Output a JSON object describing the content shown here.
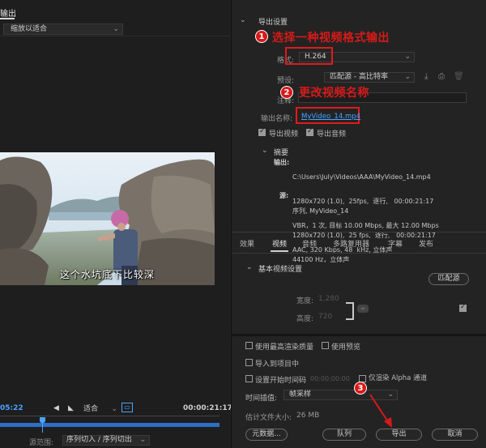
{
  "left": {
    "tab_label": "输出",
    "fit_dropdown": "缩放以适合",
    "subtitle": "这个水坑底下比较深",
    "timecode_current": "05:22",
    "timecode_total": "00:00:21:17",
    "fit_small": "适合",
    "range_label": "源范围:",
    "range_value": "序列切入 / 序列切出"
  },
  "export_settings": {
    "title": "导出设置",
    "format_label": "格式:",
    "format_value": "H.264",
    "preset_label": "预设:",
    "preset_value": "匹配源 - 高比特率",
    "comments_label": "注释:",
    "output_name_label": "输出名称:",
    "output_name_value": "MyVideo_14.mp4",
    "export_video_label": "导出视频",
    "export_audio_label": "导出音频"
  },
  "summary": {
    "title": "摘要",
    "output_label": "输出:",
    "output_lines": [
      "C:\\Users\\July\\Videos\\AAA\\MyVideo_14.mp4",
      "1280x720 (1.0),  25fps,  逐行,   00:00:21:17",
      "VBR，1 次, 目标 10.00 Mbps, 最大 12.00 Mbps",
      "AAC, 320 Kbps, 48  kHz, 立体声"
    ],
    "source_label": "源:",
    "source_lines": [
      "序列, MyVideo_14",
      "1280x720 (1.0),  25 fps,  逐行,   00:00:21:17",
      "44100 Hz，立体声"
    ]
  },
  "tabs": [
    "效果",
    "视频",
    "音频",
    "多路复用器",
    "字幕",
    "发布"
  ],
  "basic_video": {
    "title": "基本视频设置",
    "match_source_btn": "匹配源",
    "width_label": "宽度:",
    "width_value": "1,280",
    "height_label": "高度:",
    "height_value": "720"
  },
  "options": {
    "max_render_quality": "使用最高渲染质量",
    "use_previews": "使用预览",
    "import_into_project": "导入到项目中",
    "set_start_timecode": "设置开始时间码",
    "start_timecode_value": "00:00:00:00",
    "render_alpha_only": "仅渲染 Alpha 通道",
    "time_interpolation_label": "时间插值:",
    "time_interpolation_value": "帧采样",
    "estimated_size_label": "估计文件大小:",
    "estimated_size_value": "26 MB"
  },
  "buttons": {
    "metadata": "元数据...",
    "queue": "队列",
    "export": "导出",
    "cancel": "取消"
  },
  "annotations": {
    "step1_number": "1",
    "step1_text": "选择一种视频格式输出",
    "step2_number": "2",
    "step2_text": "更改视频名称",
    "step3_number": "3"
  },
  "colors": {
    "accent_blue": "#4aa3ff",
    "annotation_red": "#d81a1a"
  }
}
